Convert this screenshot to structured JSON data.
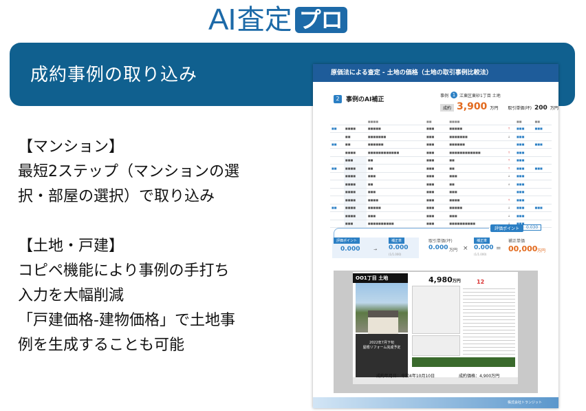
{
  "logo": {
    "ai": "AI",
    "kanji": "査定",
    "pro": "プロ"
  },
  "band": {
    "title": "成約事例の取り込み"
  },
  "left_text": {
    "lines1": [
      "【マンション】",
      "最短2ステップ（マンションの選",
      "択・部屋の選択）で取り込み"
    ],
    "lines2": [
      "【土地・戸建】",
      "コピペ機能により事例の手打ち",
      "入力を大幅削減",
      "「戸建価格-建物価格」で土地事",
      "例を生成することも可能"
    ]
  },
  "doc": {
    "header": "原価法による査定 - 土地の価格（土地の取引事例比較法）",
    "section_num": "2",
    "section_title": "事例のAI補正",
    "case_label": "事例",
    "case_num": "1",
    "case_place": "江東区東砂1丁目 土地",
    "tag": "成約",
    "price": "3,900",
    "price_unit": "万円",
    "unit_label": "取引単価(坪)",
    "unit_price": "200",
    "unit_price_unit": "万円",
    "eval_label": "評価ポイント",
    "eval_value": "0.030",
    "calc": {
      "eval_label": "評価ポイント",
      "eval_value": "0.000",
      "corr_label": "補正率",
      "corr_value": "0.000",
      "corr_sub": "(1/1.000)",
      "unit_label": "取引単価(坪)",
      "unit_value": "0.000",
      "unit_unit": "万円",
      "corr2_label": "補正率",
      "corr2_value": "0.000",
      "corr2_sub": "(1/1.000)",
      "final_label": "補正単価",
      "final_value": "00,000",
      "final_unit": "万円"
    },
    "flyer": {
      "title": "OO1丁目 土地",
      "price": "4,980",
      "price_unit": "万円",
      "badge": "12",
      "dark_text1": "2022年7月下旬",
      "dark_text2": "屋根リフォーム完成予定",
      "cap_date": "成約年月日：令和4年10月10日",
      "cap_price": "成約価格：4,900万円"
    },
    "footer": "株式会社トランジット"
  }
}
